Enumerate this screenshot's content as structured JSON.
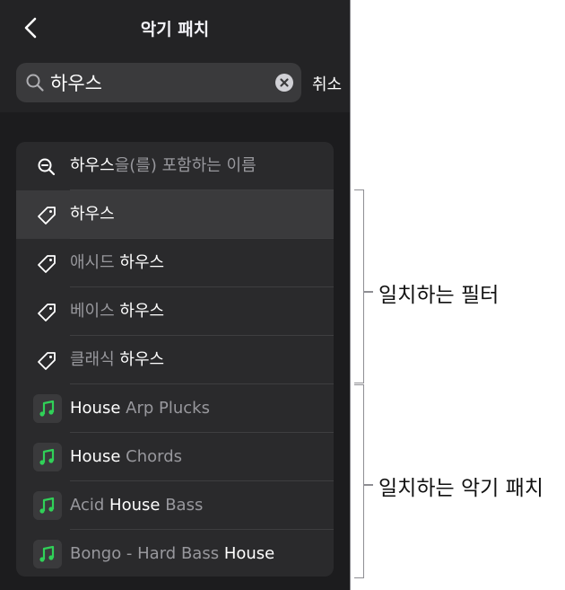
{
  "header": {
    "title": "악기 패치",
    "back_icon": "chevron-left-icon"
  },
  "search": {
    "value": "하우스",
    "cancel_label": "취소",
    "clear_icon": "clear-circle-icon"
  },
  "filter_rows": [
    {
      "icon": "search-zoom-icon",
      "match": "하우스",
      "rest": "을(를) 포함하는 이름"
    },
    {
      "icon": "tag-icon",
      "prefix": "",
      "match": "하우스"
    },
    {
      "icon": "tag-icon",
      "prefix": "애시드 ",
      "match": "하우스"
    },
    {
      "icon": "tag-icon",
      "prefix": "베이스 ",
      "match": "하우스"
    },
    {
      "icon": "tag-icon",
      "prefix": "클래식 ",
      "match": "하우스"
    }
  ],
  "patch_rows": [
    {
      "icon": "music-note-icon",
      "before": "",
      "match": "House",
      "after": " Arp Plucks"
    },
    {
      "icon": "music-note-icon",
      "before": "",
      "match": "House",
      "after": " Chords"
    },
    {
      "icon": "music-note-icon",
      "before": "Acid ",
      "match": "House",
      "after": " Bass"
    },
    {
      "icon": "music-note-icon",
      "before": "Bongo - Hard Bass ",
      "match": "House",
      "after": ""
    }
  ],
  "annotations": {
    "filters_label": "일치하는 필터",
    "patches_label": "일치하는 악기 패치"
  },
  "colors": {
    "panel": "#1c1c1e",
    "accent_green": "#30d158",
    "text": "#ffffff",
    "dim_text": "#98989d"
  }
}
